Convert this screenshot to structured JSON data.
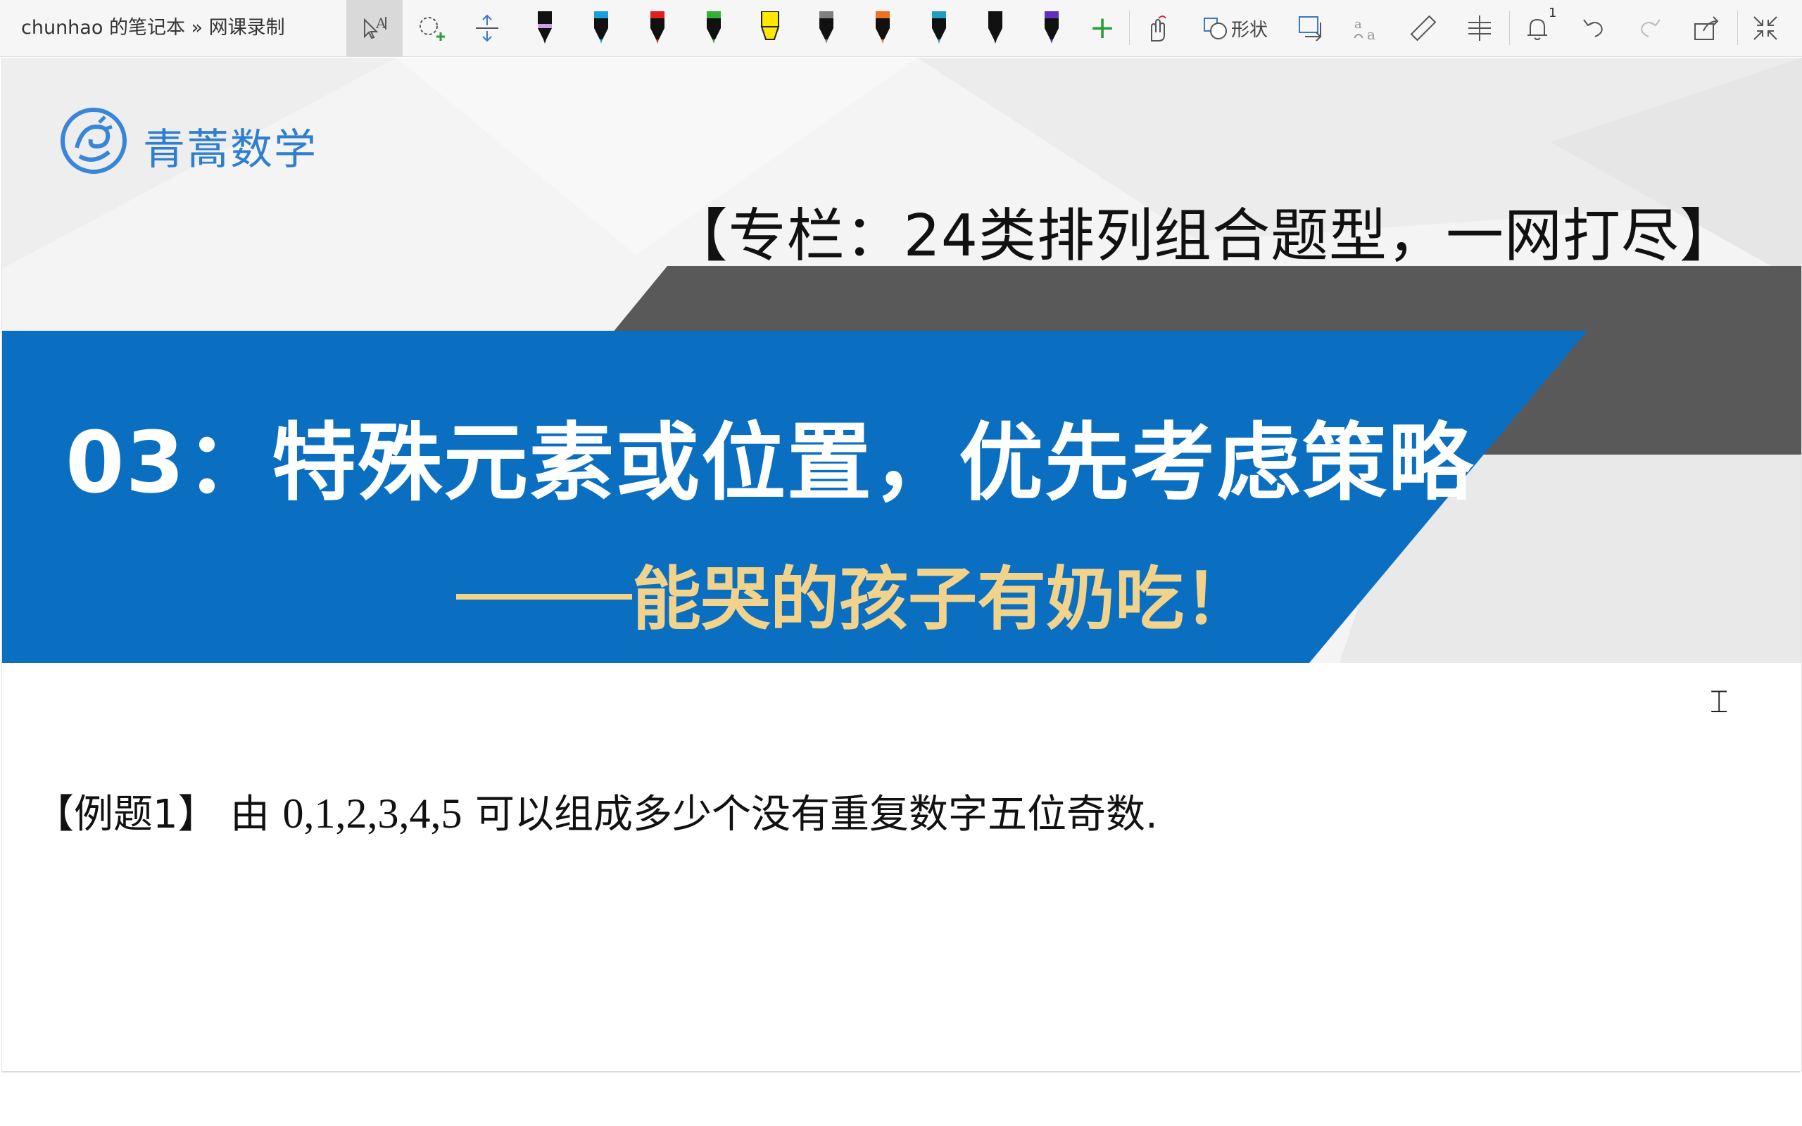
{
  "toolbar": {
    "notebook_title": "chunhao 的笔记本 » 网课录制",
    "shape_label": "形状",
    "notification_count": "1",
    "pen_colors": [
      "#c9a0e0",
      "#1aa0e0",
      "#e02020",
      "#34b034",
      "#ffe800",
      "#808080",
      "#f07020",
      "#20a0c0",
      "#111111",
      "#6030c0"
    ],
    "pens": [
      {
        "name": "pen-black",
        "cap": "#111111",
        "band": "#c9a0e0"
      },
      {
        "name": "pen-blue",
        "cap": "#1aa0e0",
        "band": "#111111"
      },
      {
        "name": "pen-red",
        "cap": "#e02020",
        "band": "#111111"
      },
      {
        "name": "pen-green",
        "cap": "#34b034",
        "band": "#111111"
      },
      {
        "name": "highlighter-yellow",
        "cap": "#ffe800",
        "band": "#ffe800"
      },
      {
        "name": "pencil-gray",
        "cap": "#808080",
        "band": "#111111"
      },
      {
        "name": "pen-rainbow",
        "cap": "#f07020",
        "band": "#111111"
      },
      {
        "name": "pen-galaxy",
        "cap": "#20a0c0",
        "band": "#111111"
      },
      {
        "name": "pen-black-2",
        "cap": "#111111",
        "band": "#111111"
      },
      {
        "name": "pen-purple",
        "cap": "#6030c0",
        "band": "#111111"
      }
    ]
  },
  "slide": {
    "logo_text": "青蒿数学",
    "column_title": "【专栏：24类排列组合题型，一网打尽】",
    "banner_title": "03：特殊元素或位置，优先考虑策略",
    "banner_subtitle": "能哭的孩子有奶吃！",
    "colors": {
      "banner_blue": "#0b6fc1",
      "banner_gray": "#595959",
      "subtitle_gold": "#f1d38c",
      "logo_blue": "#2f7fd0"
    }
  },
  "example": {
    "tag": "【例题1】",
    "prefix": "由",
    "numbers": "0,1,2,3,4,5",
    "text": "可以组成多少个没有重复数字五位奇数."
  }
}
